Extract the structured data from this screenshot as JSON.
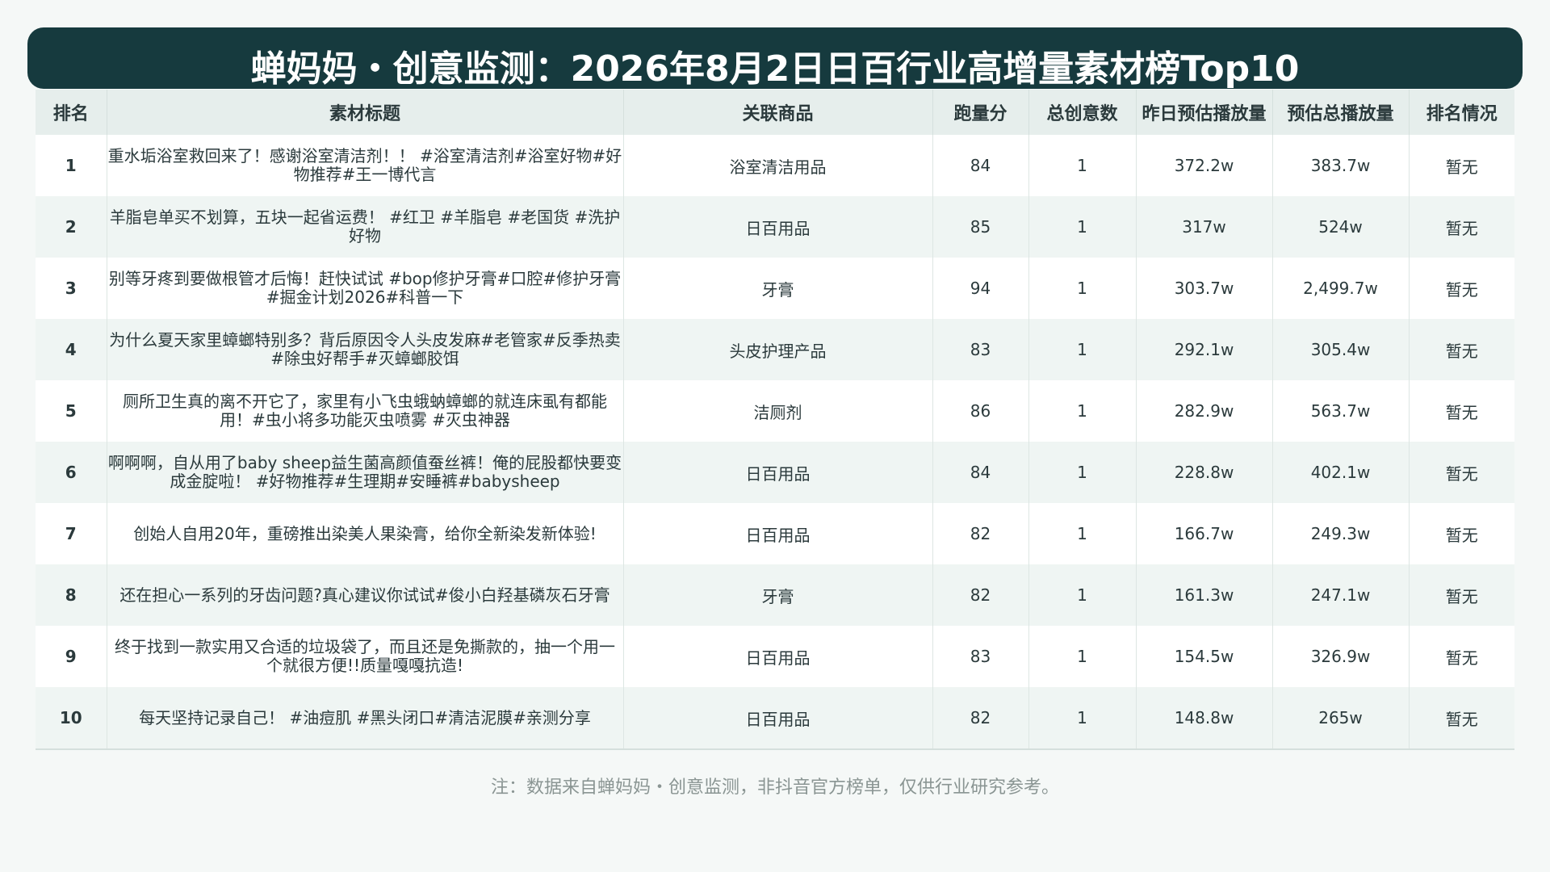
{
  "header": {
    "title": "蝉妈妈・创意监测：2026年8月2日日百行业高增量素材榜Top10"
  },
  "table": {
    "columns": [
      "排名",
      "素材标题",
      "关联商品",
      "跑量分",
      "总创意数",
      "昨日预估播放量",
      "预估总播放量",
      "排名情况"
    ],
    "rows": [
      {
        "rank": "1",
        "title": "重水垢浴室救回来了！感谢浴室清洁剂！！ #浴室清洁剂#浴室好物#好物推荐#王一博代言",
        "product": "浴室清洁用品",
        "score": "84",
        "creatives": "1",
        "yesterday": "372.2w",
        "total": "383.7w",
        "status": "暂无"
      },
      {
        "rank": "2",
        "title": "羊脂皂单买不划算，五块一起省运费！ #红卫 #羊脂皂 #老国货 #洗护好物",
        "product": "日百用品",
        "score": "85",
        "creatives": "1",
        "yesterday": "317w",
        "total": "524w",
        "status": "暂无"
      },
      {
        "rank": "3",
        "title": "别等牙疼到要做根管才后悔！赶快试试 #bop修护牙膏#口腔#修护牙膏#掘金计划2026#科普一下",
        "product": "牙膏",
        "score": "94",
        "creatives": "1",
        "yesterday": "303.7w",
        "total": "2,499.7w",
        "status": "暂无"
      },
      {
        "rank": "4",
        "title": "为什么夏天家里蟑螂特别多？背后原因令人头皮发麻#老管家#反季热卖#除虫好帮手#灭蟑螂胶饵",
        "product": "头皮护理产品",
        "score": "83",
        "creatives": "1",
        "yesterday": "292.1w",
        "total": "305.4w",
        "status": "暂无"
      },
      {
        "rank": "5",
        "title": "厕所卫生真的离不开它了，家里有小飞虫蛾蚋蟑螂的就连床虱有都能用！#虫小将多功能灭虫喷雾 #灭虫神器",
        "product": "洁厕剂",
        "score": "86",
        "creatives": "1",
        "yesterday": "282.9w",
        "total": "563.7w",
        "status": "暂无"
      },
      {
        "rank": "6",
        "title": "啊啊啊，自从用了baby sheep益生菌高颜值蚕丝裤！俺的屁股都快要变成金腚啦！ #好物推荐#生理期#安睡裤#babysheep",
        "product": "日百用品",
        "score": "84",
        "creatives": "1",
        "yesterday": "228.8w",
        "total": "402.1w",
        "status": "暂无"
      },
      {
        "rank": "7",
        "title": "创始人自用20年，重磅推出染美人果染膏，给你全新染发新体验!",
        "product": "日百用品",
        "score": "82",
        "creatives": "1",
        "yesterday": "166.7w",
        "total": "249.3w",
        "status": "暂无"
      },
      {
        "rank": "8",
        "title": "还在担心一系列的牙齿问题?真心建议你试试#俊小白羟基磷灰石牙膏",
        "product": "牙膏",
        "score": "82",
        "creatives": "1",
        "yesterday": "161.3w",
        "total": "247.1w",
        "status": "暂无"
      },
      {
        "rank": "9",
        "title": "终于找到一款实用又合适的垃圾袋了，而且还是免撕款的，抽一个用一个就很方便!!质量嘎嘎抗造!",
        "product": "日百用品",
        "score": "83",
        "creatives": "1",
        "yesterday": "154.5w",
        "total": "326.9w",
        "status": "暂无"
      },
      {
        "rank": "10",
        "title": "每天坚持记录自己！ #油痘肌 #黑头闭口#清洁泥膜#亲测分享",
        "product": "日百用品",
        "score": "82",
        "creatives": "1",
        "yesterday": "148.8w",
        "total": "265w",
        "status": "暂无"
      }
    ]
  },
  "footer": {
    "note": "注：数据来自蝉妈妈・创意监测，非抖音官方榜单，仅供行业研究参考。"
  }
}
